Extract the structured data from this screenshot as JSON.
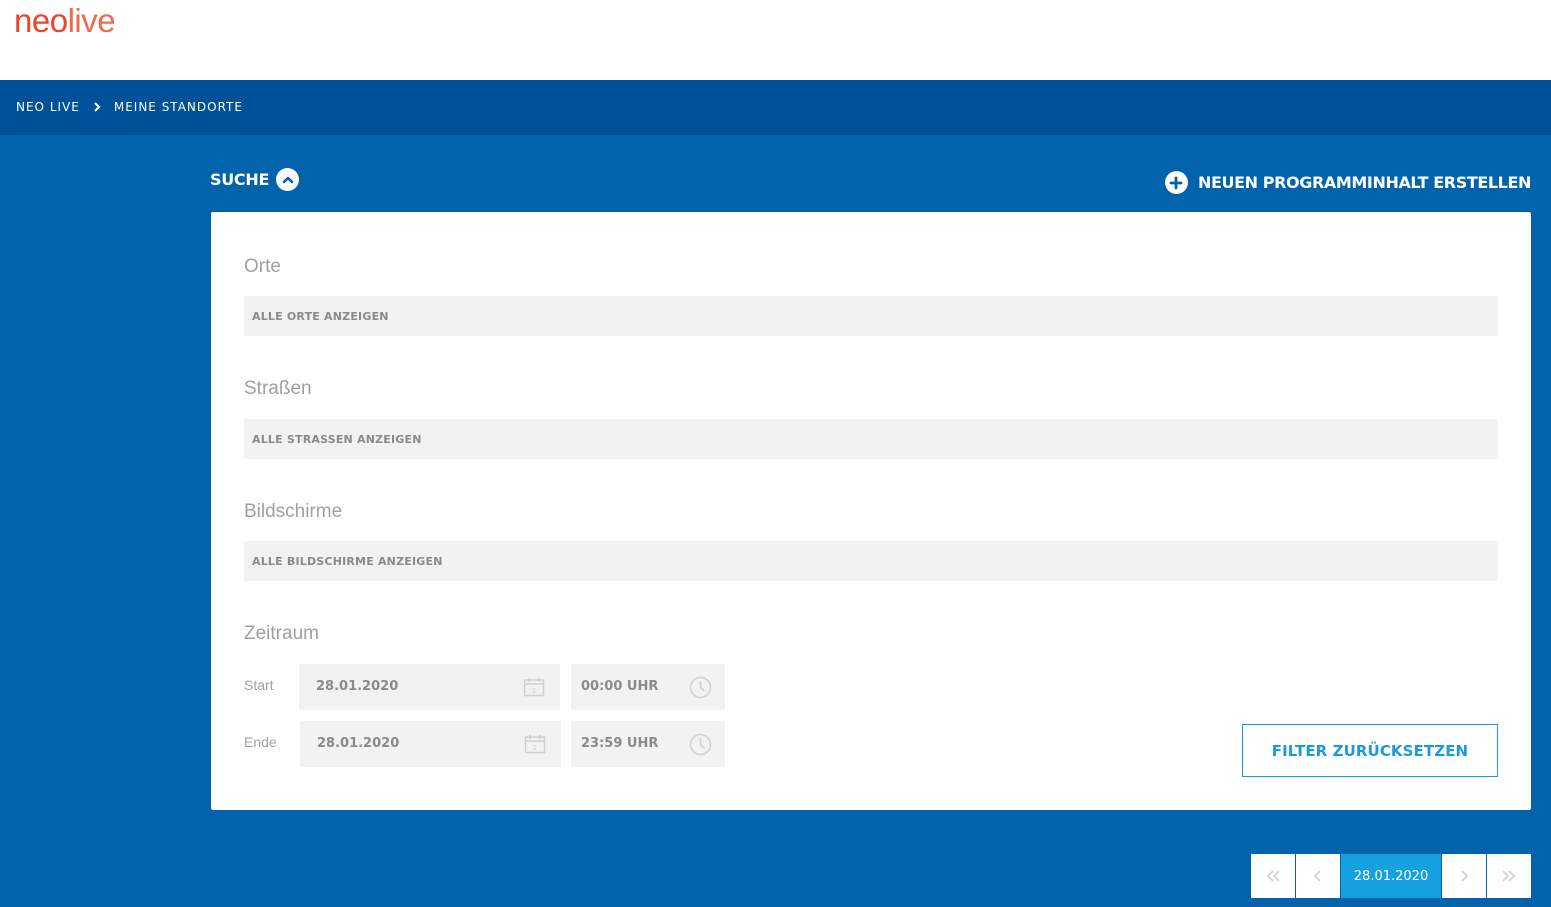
{
  "brand": {
    "logo_neo": "neo",
    "logo_live": "live"
  },
  "breadcrumb": {
    "items": [
      "NEO LIVE",
      "MEINE STANDORTE"
    ]
  },
  "search": {
    "label": "SUCHE"
  },
  "actions": {
    "new_content_label": "NEUEN PROGRAMMINHALT ERSTELLEN"
  },
  "filters": {
    "orte": {
      "label": "Orte",
      "value": "ALLE ORTE ANZEIGEN"
    },
    "strassen": {
      "label": "Straßen",
      "value": "ALLE STRASSEN ANZEIGEN"
    },
    "bildschirme": {
      "label": "Bildschirme",
      "value": "ALLE BILDSCHIRME ANZEIGEN"
    },
    "zeitraum": {
      "label": "Zeitraum",
      "start": {
        "label": "Start",
        "date": "28.01.2020",
        "time": "00:00 UHR"
      },
      "ende": {
        "label": "Ende",
        "date": "28.01.2020",
        "time": "23:59 UHR"
      }
    },
    "reset_label": "FILTER ZURÜCKSETZEN"
  },
  "pagination": {
    "current": "28.01.2020"
  },
  "colors": {
    "brand_orange": "#e8452a",
    "primary_blue": "#0063ac",
    "breadcrumb_blue": "#01519a",
    "accent_blue": "#15a0e0"
  },
  "icons": {
    "breadcrumb_sep": "chevron-right-icon",
    "search_toggle": "chevron-up-icon",
    "new_content": "plus-icon",
    "date": "calendar-icon",
    "time": "clock-icon",
    "pager": [
      "double-chevron-left-icon",
      "chevron-left-icon",
      "chevron-right-icon",
      "double-chevron-right-icon"
    ]
  }
}
